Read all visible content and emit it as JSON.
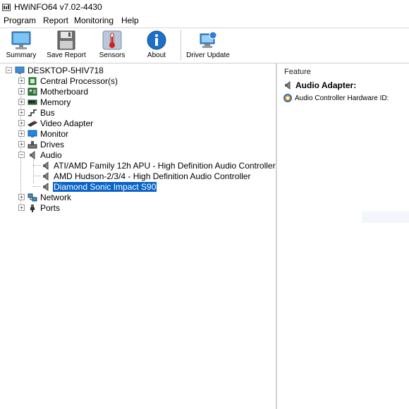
{
  "window": {
    "title": "HWiNFO64 v7.02-4430"
  },
  "menu": {
    "items": [
      "Program",
      "Report",
      "Monitoring",
      "Help"
    ]
  },
  "toolbar": {
    "buttons": [
      {
        "label": "Summary",
        "icon": "monitor-icon"
      },
      {
        "label": "Save Report",
        "icon": "floppy-disk-icon"
      },
      {
        "label": "Sensors",
        "icon": "thermometer-icon"
      },
      {
        "label": "About",
        "icon": "info-icon"
      },
      {
        "label": "Driver Update",
        "icon": "driver-update-icon"
      }
    ]
  },
  "tree": {
    "root": "DESKTOP-5HIV718",
    "items": [
      {
        "label": "Central Processor(s)",
        "icon": "cpu-icon"
      },
      {
        "label": "Motherboard",
        "icon": "motherboard-icon"
      },
      {
        "label": "Memory",
        "icon": "memory-icon"
      },
      {
        "label": "Bus",
        "icon": "bus-icon"
      },
      {
        "label": "Video Adapter",
        "icon": "video-adapter-icon"
      },
      {
        "label": "Monitor",
        "icon": "monitor-icon"
      },
      {
        "label": "Drives",
        "icon": "drive-icon"
      },
      {
        "label": "Audio",
        "icon": "speaker-icon",
        "expanded": true
      },
      {
        "label": "Network",
        "icon": "network-icon"
      },
      {
        "label": "Ports",
        "icon": "port-icon"
      }
    ],
    "audio_children": [
      "ATI/AMD Family 12h APU - High Definition Audio Controller",
      "AMD Hudson-2/3/4 - High Definition Audio Controller",
      "Diamond Sonic Impact S90"
    ],
    "selected": "Diamond Sonic Impact S90"
  },
  "details": {
    "header": "Feature",
    "section_title": "Audio Adapter:",
    "fields": [
      {
        "label": "Audio Controller Hardware ID:",
        "value": ""
      }
    ]
  },
  "colors": {
    "selection": "#0a64c8",
    "accent_blue": "#1e6fc8"
  }
}
